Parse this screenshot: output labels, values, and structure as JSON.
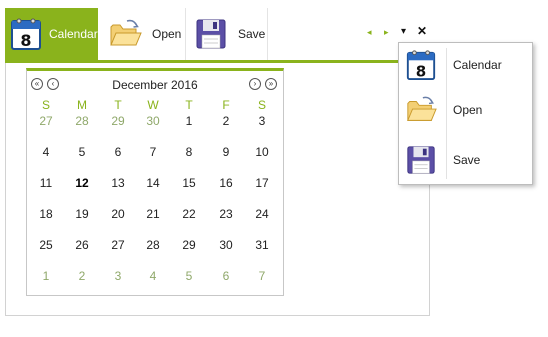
{
  "tabs": [
    {
      "label": "Calendar",
      "icon": "calendar-icon",
      "active": true
    },
    {
      "label": "Open",
      "icon": "folder-open-icon"
    },
    {
      "label": "Save",
      "icon": "floppy-disk-icon"
    }
  ],
  "calendar_icon_number": "8",
  "controls": {
    "scroll_left": "◂",
    "scroll_right": "▸",
    "dropdown": "▾",
    "close": "✕"
  },
  "calendar": {
    "title": "December 2016",
    "nav": {
      "prev_year": "«",
      "prev_month": "‹",
      "next_month": "›",
      "next_year": "»"
    },
    "weekdays": [
      "S",
      "M",
      "T",
      "W",
      "T",
      "F",
      "S"
    ],
    "weeks": [
      [
        "27",
        "28",
        "29",
        "30",
        "1",
        "2",
        "3"
      ],
      [
        "4",
        "5",
        "6",
        "7",
        "8",
        "9",
        "10"
      ],
      [
        "11",
        "12",
        "13",
        "14",
        "15",
        "16",
        "17"
      ],
      [
        "18",
        "19",
        "20",
        "21",
        "22",
        "23",
        "24"
      ],
      [
        "25",
        "26",
        "27",
        "28",
        "29",
        "30",
        "31"
      ],
      [
        "1",
        "2",
        "3",
        "4",
        "5",
        "6",
        "7"
      ]
    ],
    "today": "12"
  },
  "menu": [
    {
      "label": "Calendar",
      "icon": "calendar-icon"
    },
    {
      "label": "Open",
      "icon": "folder-open-icon"
    },
    {
      "label": "Save",
      "icon": "floppy-disk-icon"
    }
  ],
  "colors": {
    "accent": "#8ab31c",
    "other_month": "#8fa86a",
    "weekday": "#8ab31c"
  }
}
